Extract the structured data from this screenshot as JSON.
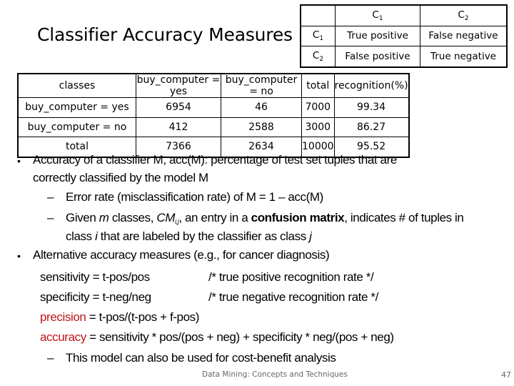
{
  "slide": {
    "title": "Classifier Accuracy Measures",
    "footer": "Data Mining: Concepts and Techniques",
    "page_number": "47"
  },
  "confusion_legend": {
    "col_headers": [
      {
        "base": "C",
        "sub": "1"
      },
      {
        "base": "C",
        "sub": "2"
      }
    ],
    "rows": [
      {
        "label": {
          "base": "C",
          "sub": "1"
        },
        "cells": [
          "True positive",
          "False negative"
        ]
      },
      {
        "label": {
          "base": "C",
          "sub": "2"
        },
        "cells": [
          "False positive",
          "True negative"
        ]
      }
    ]
  },
  "data_table": {
    "headers": [
      "classes",
      "buy_computer = yes",
      "buy_computer = no",
      "total",
      "recognition(%)"
    ],
    "rows": [
      [
        "buy_computer = yes",
        "6954",
        "46",
        "7000",
        "99.34"
      ],
      [
        "buy_computer = no",
        "412",
        "2588",
        "3000",
        "86.27"
      ],
      [
        "total",
        "7366",
        "2634",
        "10000",
        "95.52"
      ]
    ]
  },
  "content": {
    "bullet1_line1": "Accuracy of a classifier M, acc(M): percentage of test set tuples that are",
    "bullet1_line2": "correctly classified by the model M",
    "sub1": "Error rate (misclassification rate) of M = 1 – acc(M)",
    "sub2_a": "Given ",
    "sub2_m": "m",
    "sub2_b": " classes, ",
    "sub2_cm": "CM",
    "sub2_cm_sub": "i,j",
    "sub2_c": ", an entry in a ",
    "sub2_bold": "confusion matrix",
    "sub2_d": ", indicates # of tuples in",
    "sub2_line2_a": "class ",
    "sub2_line2_i": "i",
    "sub2_line2_b": "  that are labeled by the classifier as class ",
    "sub2_line2_j": "j",
    "bullet2": "Alternative accuracy measures (e.g., for cancer diagnosis)",
    "sensitivity_formula": "sensitivity = t-pos/pos",
    "sensitivity_comment": "/* true positive recognition rate */",
    "specificity_formula": "specificity = t-neg/neg",
    "specificity_comment": "/* true negative recognition rate */",
    "precision_term": "precision",
    "precision_formula": " =  t-pos/(t-pos + f-pos)",
    "accuracy_term": "accuracy",
    "accuracy_formula": " = sensitivity * pos/(pos + neg) + specificity * neg/(pos + neg)",
    "sub3": "This model can also be used for cost-benefit analysis",
    "bullet_glyph": "•",
    "dash_glyph": "–"
  },
  "colors": {
    "highlight_red": "#c0141c"
  }
}
